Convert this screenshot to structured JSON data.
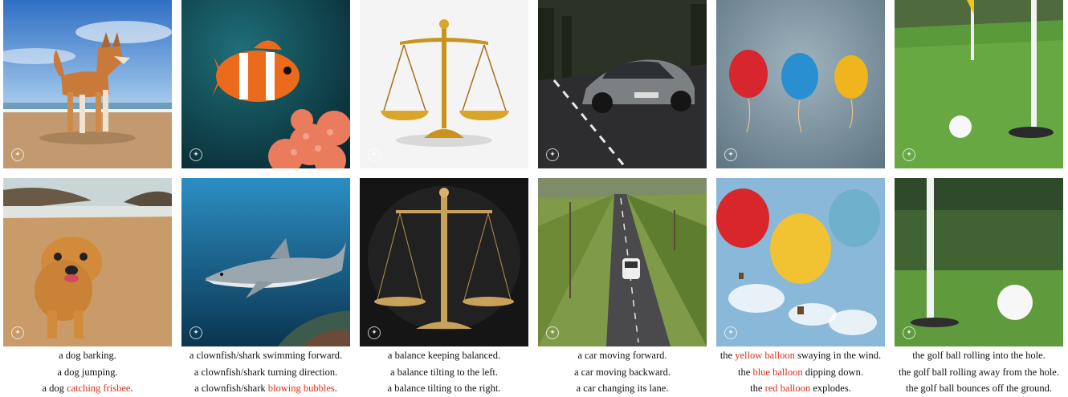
{
  "watermark_icon": "sparkle-logo-icon",
  "highlight_color": "#d9301c",
  "tiles": [
    {
      "top": "dog on beach with blue sky",
      "bottom": "golden retriever on beach"
    },
    {
      "top": "clownfish near coral",
      "bottom": "shark underwater"
    },
    {
      "top": "golden balance scale on white",
      "bottom": "balance scale on dark background"
    },
    {
      "top": "grey sports car on road",
      "bottom": "aerial view of car on country road"
    },
    {
      "top": "red, blue and yellow balloons",
      "bottom": "hot air balloons in sky"
    },
    {
      "top": "golf ball near hole with flag",
      "bottom": "golf ball on green near flagpole"
    }
  ],
  "captions": [
    {
      "lines": [
        {
          "pre": "a dog barking.",
          "hl": "",
          "post": ""
        },
        {
          "pre": "a dog jumping.",
          "hl": "",
          "post": ""
        },
        {
          "pre": "a dog ",
          "hl": "catching frisbee",
          "post": "."
        }
      ]
    },
    {
      "lines": [
        {
          "pre": "a clownfish/shark swimming forward.",
          "hl": "",
          "post": ""
        },
        {
          "pre": "a clownfish/shark turning direction.",
          "hl": "",
          "post": ""
        },
        {
          "pre": "a clownfish/shark ",
          "hl": "blowing bubbles",
          "post": "."
        }
      ]
    },
    {
      "lines": [
        {
          "pre": "a balance keeping balanced.",
          "hl": "",
          "post": ""
        },
        {
          "pre": "a balance tilting to the left.",
          "hl": "",
          "post": ""
        },
        {
          "pre": "a balance tilting to the right.",
          "hl": "",
          "post": ""
        }
      ]
    },
    {
      "lines": [
        {
          "pre": "a car moving forward.",
          "hl": "",
          "post": ""
        },
        {
          "pre": "a car moving backward.",
          "hl": "",
          "post": ""
        },
        {
          "pre": "a car changing its lane.",
          "hl": "",
          "post": ""
        }
      ]
    },
    {
      "lines": [
        {
          "pre": "the ",
          "hl": "yellow balloon",
          "post": " swaying in the wind."
        },
        {
          "pre": "the ",
          "hl": "blue balloon",
          "post": " dipping down."
        },
        {
          "pre": "the ",
          "hl": "red balloon",
          "post": " explodes."
        }
      ]
    },
    {
      "lines": [
        {
          "pre": "the golf ball rolling into the hole.",
          "hl": "",
          "post": ""
        },
        {
          "pre": "the golf ball rolling away from the hole.",
          "hl": "",
          "post": ""
        },
        {
          "pre": "the golf ball bounces off the ground.",
          "hl": "",
          "post": ""
        }
      ]
    }
  ]
}
